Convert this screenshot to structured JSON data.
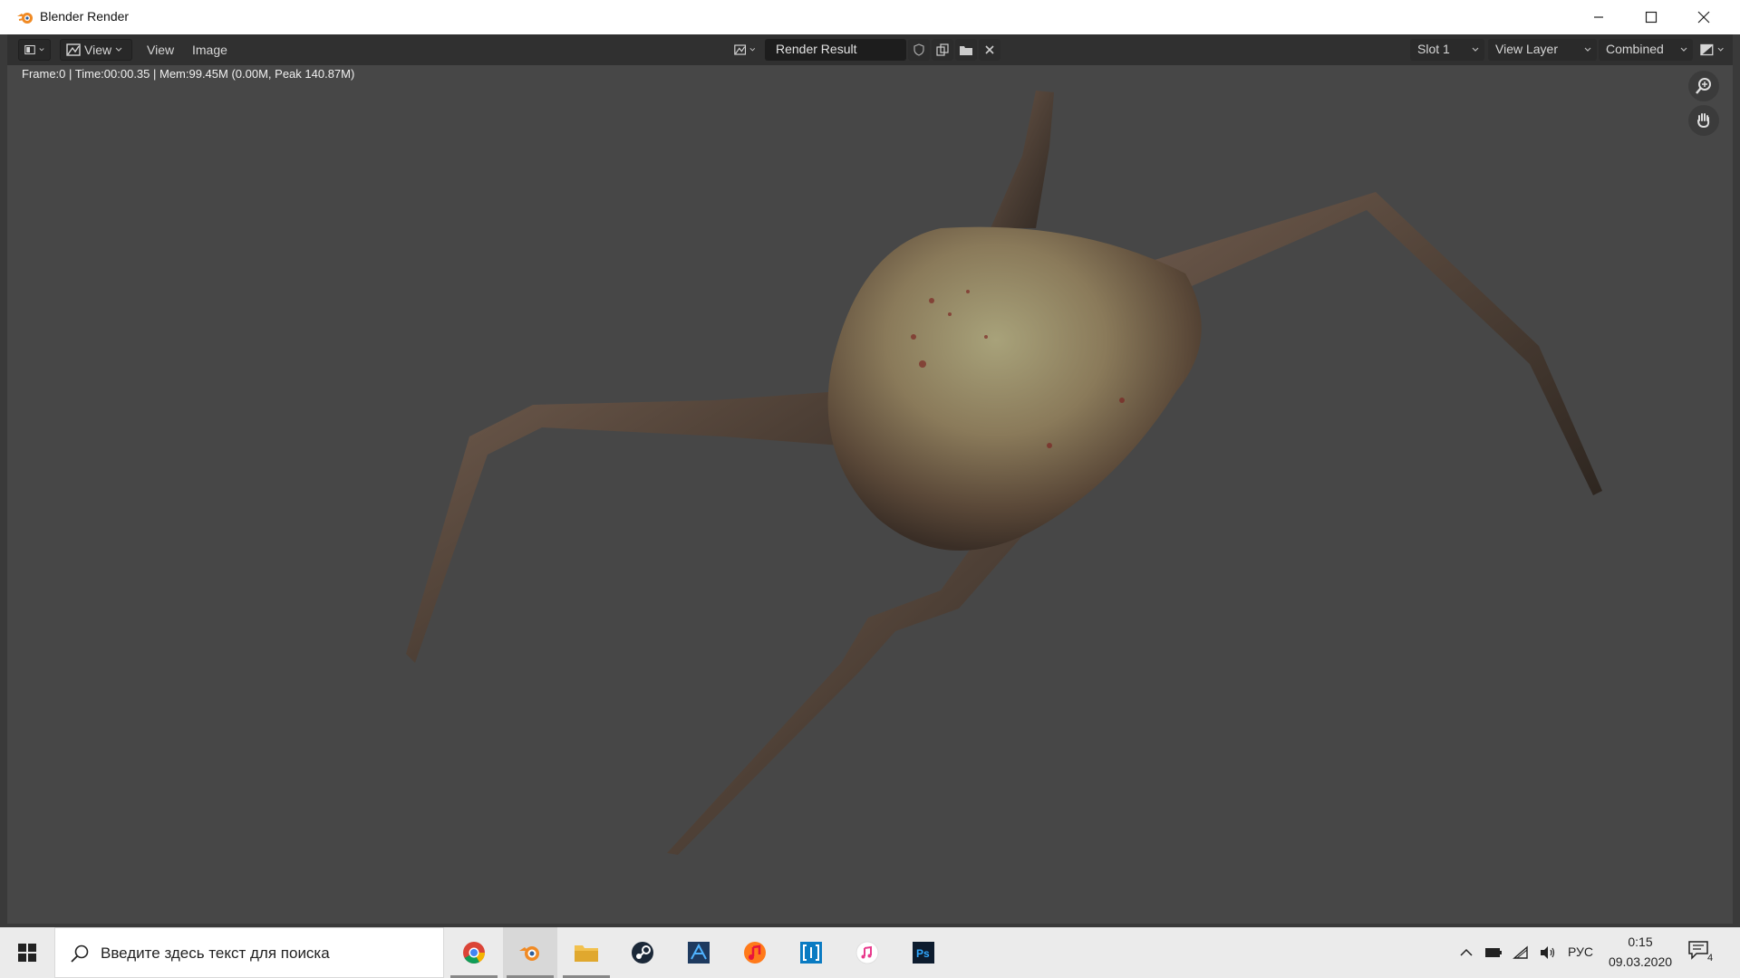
{
  "window": {
    "title": "Blender Render"
  },
  "header": {
    "view_menu_label": "View",
    "menus": [
      "View",
      "Image"
    ],
    "image_name": "Render Result",
    "slot": "Slot 1",
    "view_layer": "View Layer",
    "pass": "Combined"
  },
  "viewport": {
    "render_info": "Frame:0 | Time:00:00.35 | Mem:99.45M (0.00M, Peak 140.87M)"
  },
  "taskbar": {
    "search_placeholder": "Введите здесь текст для поиска",
    "apps": [
      "chrome-icon",
      "blender-icon",
      "file-explorer-icon",
      "steam-icon",
      "app-blue-icon",
      "music-app-icon",
      "jump-app-icon",
      "itunes-icon",
      "photoshop-icon"
    ],
    "photoshop_label": "Ps",
    "language": "РУС",
    "time": "0:15",
    "date": "09.03.2020",
    "notification_count": "4"
  },
  "colors": {
    "viewport_bg": "#474747",
    "header_bg": "#303030",
    "taskbar_bg": "#ebebeb"
  }
}
